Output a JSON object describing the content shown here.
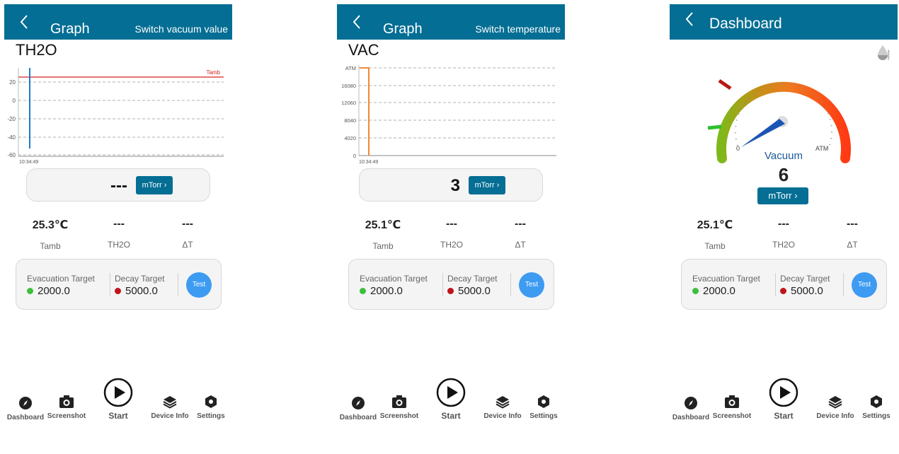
{
  "screen1": {
    "header": {
      "title": "Graph",
      "action": "Switch vacuum value"
    },
    "graph_label": "TH2O",
    "chart_data": {
      "type": "line",
      "y_ticks": [
        "20",
        "0",
        "-20",
        "-40",
        "-60"
      ],
      "x_tick": "10:34:49",
      "reference_line_label": "Tamb",
      "series": [
        {
          "values": [
            -52,
            35
          ],
          "color": "#1e7bcf"
        }
      ],
      "reference_value": 25,
      "ylim": [
        -62,
        35
      ],
      "grid": "dashed"
    },
    "unit_card": {
      "value": "---",
      "button": "mTorr ›"
    },
    "readings": [
      {
        "value": "25.3℃",
        "label": "Tamb"
      },
      {
        "value": "---",
        "label": "TH2O"
      },
      {
        "value": "---",
        "label": "ΔT"
      }
    ],
    "targets": {
      "evacuation_label": "Evacuation Target",
      "evacuation_value": "2000.0",
      "decay_label": "Decay Target",
      "decay_value": "5000.0",
      "test_button": "Test"
    }
  },
  "screen2": {
    "header": {
      "title": "Graph",
      "action": "Switch temperature"
    },
    "graph_label": "VAC",
    "chart_data": {
      "type": "line",
      "y_ticks": [
        "ATM",
        "16080",
        "12060",
        "8040",
        "4020",
        "0"
      ],
      "x_tick": "10:34:49",
      "series": [
        {
          "values": [
            20100,
            20100,
            0
          ],
          "color": "#f07c1e"
        }
      ],
      "ylim": [
        0,
        20100
      ],
      "grid": "dashed"
    },
    "unit_card": {
      "value": "3",
      "button": "mTorr ›"
    },
    "readings": [
      {
        "value": "25.1℃",
        "label": "Tamb"
      },
      {
        "value": "---",
        "label": "TH2O"
      },
      {
        "value": "---",
        "label": "ΔT"
      }
    ],
    "targets": {
      "evacuation_label": "Evacuation Target",
      "evacuation_value": "2000.0",
      "decay_label": "Decay Target",
      "decay_value": "5000.0",
      "test_button": "Test"
    }
  },
  "screen3": {
    "header": {
      "title": "Dashboard"
    },
    "gauge": {
      "min_label": "0",
      "max_label": "ATM",
      "title": "Vacuum",
      "value": "6",
      "unit_button": "mTorr ›",
      "needle_fraction": 0.06
    },
    "readings": [
      {
        "value": "25.1℃",
        "label": "Tamb"
      },
      {
        "value": "---",
        "label": "TH2O"
      },
      {
        "value": "---",
        "label": "ΔT"
      }
    ],
    "targets": {
      "evacuation_label": "Evacuation Target",
      "evacuation_value": "2000.0",
      "decay_label": "Decay Target",
      "decay_value": "5000.0",
      "test_button": "Test"
    }
  },
  "nav": {
    "dashboard": "Dashboard",
    "screenshot": "Screenshot",
    "start": "Start",
    "device_info": "Device Info",
    "settings": "Settings"
  },
  "colors": {
    "header": "#046e94",
    "evacuation_dot": "#3cbf3c",
    "decay_dot": "#c0141c",
    "test_button": "#3d9bf2"
  }
}
